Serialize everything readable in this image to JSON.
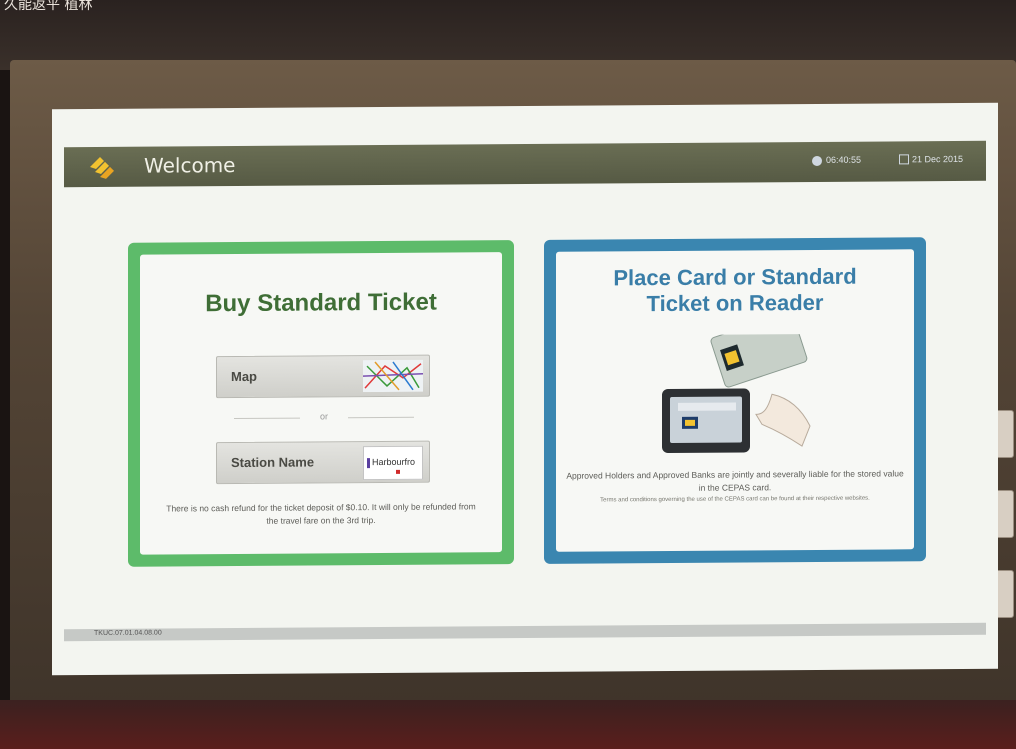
{
  "kiosk": {
    "top_text": "久能返平 植林"
  },
  "header": {
    "title": "Welcome",
    "time": "06:40:55",
    "date": "21 Dec 2015"
  },
  "buy": {
    "title": "Buy Standard Ticket",
    "map_label": "Map",
    "or_label": "or",
    "station_label": "Station Name",
    "station_thumb_text": "Harbourfro",
    "refund_note": "There is no cash refund for the ticket deposit of $0.10. It will only be refunded from the travel fare on the 3rd trip."
  },
  "place": {
    "title_line1": "Place Card or Standard",
    "title_line2": "Ticket on Reader",
    "approved_note": "Approved Holders and Approved Banks are jointly and severally liable for the stored value in the CEPAS card.",
    "terms_note": "Terms and conditions governing the use of the CEPAS card can be found at their respective websites."
  },
  "status": {
    "text": "TKUC.07.01.04.08.00"
  },
  "colors": {
    "header_bg": "#5f634b",
    "green_border": "#5dbb6a",
    "blue_border": "#3a86b0",
    "buy_title": "#3f6e36",
    "place_title": "#3a7ea8"
  },
  "icons": {
    "logo": "transit-logo-icon",
    "clock": "clock-icon",
    "calendar": "calendar-icon",
    "map": "map-thumbnail-icon",
    "reader": "card-reader-icon"
  }
}
